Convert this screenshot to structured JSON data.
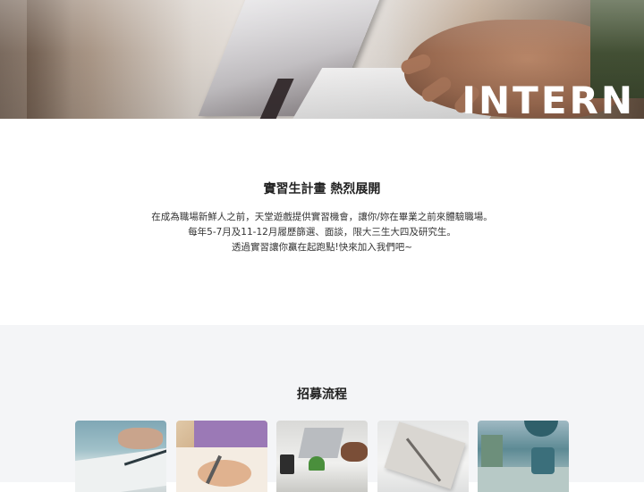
{
  "hero": {
    "title": "INTERN"
  },
  "intro": {
    "heading": "實習生計畫 熱烈展開",
    "lines": [
      "在成為職場新鮮人之前，天堂遊戲提供實習機會，讓你/妳在畢業之前來體驗職場。",
      "每年5-7月及11-12月履歷篩選、面談，限大三生大四及研究生。",
      "透過實習讓你贏在起跑點!快來加入我們吧~"
    ]
  },
  "process": {
    "heading": "招募流程"
  },
  "colors": {
    "background": "#ffffff",
    "section_gray": "#f4f5f7",
    "heading_text": "#222222",
    "body_text": "#333333",
    "hero_title": "#ffffff"
  }
}
